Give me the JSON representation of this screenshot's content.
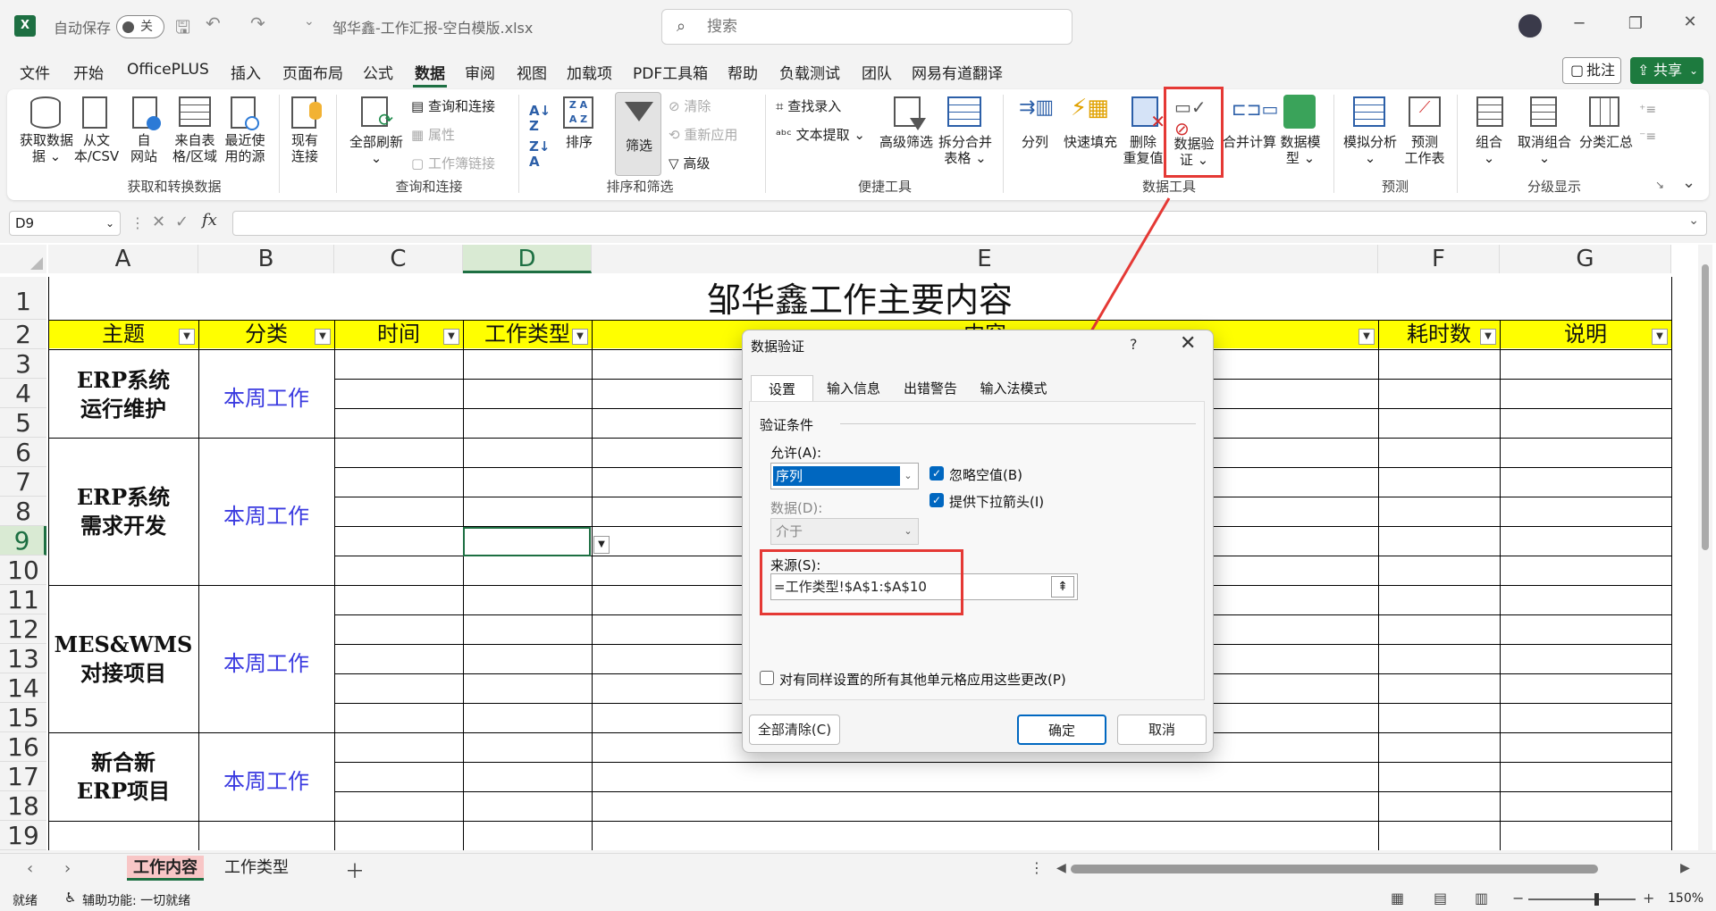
{
  "titlebar": {
    "autosave_label": "自动保存",
    "autosave_state": "关",
    "filename": "邹华鑫-工作汇报-空白模版.xlsx",
    "search_placeholder": "搜索"
  },
  "menu": {
    "items": [
      "文件",
      "开始",
      "OfficePLUS",
      "插入",
      "页面布局",
      "公式",
      "数据",
      "审阅",
      "视图",
      "加载项",
      "PDF工具箱",
      "帮助",
      "负载测试",
      "团队",
      "网易有道翻译"
    ],
    "active": "数据",
    "comment": "批注",
    "share": "共享"
  },
  "ribbon": {
    "get_data": "获取数据",
    "from_text_1": "从文",
    "from_text_2": "本/CSV",
    "from_web_1": "自",
    "from_web_2": "网站",
    "from_table_1": "来自表",
    "from_table_2": "格/区域",
    "recent_1": "最近使",
    "recent_2": "用的源",
    "existing_1": "现有",
    "existing_2": "连接",
    "group_get": "获取和转换数据",
    "refresh_all": "全部刷新",
    "query_conn": "查询和连接",
    "properties": "属性",
    "workbook_links": "工作簿链接",
    "group_query": "查询和连接",
    "sort": "排序",
    "filter": "筛选",
    "clear": "清除",
    "reapply": "重新应用",
    "advanced": "高级",
    "group_sort": "排序和筛选",
    "find_entry": "查找录入",
    "text_extract": "文本提取",
    "adv_filter": "高级筛选",
    "split_merge_1": "拆分合并",
    "split_merge_2": "表格",
    "group_tools": "便捷工具",
    "split_col": "分列",
    "flash_fill": "快速填充",
    "remove_dup_1": "删除",
    "remove_dup_2": "重复值",
    "validation_1": "数据验",
    "validation_2": "证",
    "consolidate": "合并计算",
    "data_model_1": "数据模",
    "data_model_2": "型",
    "group_datatools": "数据工具",
    "what_if": "模拟分析",
    "forecast_1": "预测",
    "forecast_2": "工作表",
    "group_forecast": "预测",
    "group_btn": "组合",
    "ungroup": "取消组合",
    "subtotal": "分类汇总",
    "group_outline": "分级显示"
  },
  "formula": {
    "namebox": "D9",
    "fx": "fx"
  },
  "columns": [
    "A",
    "B",
    "C",
    "D",
    "E",
    "F",
    "G"
  ],
  "rows": [
    "1",
    "2",
    "3",
    "4",
    "5",
    "6",
    "7",
    "8",
    "9",
    "10",
    "11",
    "12",
    "13",
    "14",
    "15",
    "16",
    "17",
    "18",
    "19"
  ],
  "sheet": {
    "title": "邹华鑫工作主要内容",
    "headers": [
      "主题",
      "分类",
      "时间",
      "工作类型",
      "内容",
      "耗时数",
      "说明"
    ],
    "sections": [
      {
        "topic_1": "ERP系统",
        "topic_2": "运行维护",
        "category": "本周工作"
      },
      {
        "topic_1": "ERP系统",
        "topic_2": "需求开发",
        "category": "本周工作"
      },
      {
        "topic_1": "MES&WMS",
        "topic_2": "对接项目",
        "category": "本周工作"
      },
      {
        "topic_1": "新合新",
        "topic_2": "ERP项目",
        "category": "本周工作"
      }
    ]
  },
  "dialog": {
    "title": "数据验证",
    "help": "?",
    "tabs": [
      "设置",
      "输入信息",
      "出错警告",
      "输入法模式"
    ],
    "section": "验证条件",
    "allow_label": "允许(A):",
    "allow_value": "序列",
    "ignore_blank": "忽略空值(B)",
    "dropdown": "提供下拉箭头(I)",
    "data_label": "数据(D):",
    "data_value": "介于",
    "source_label": "来源(S):",
    "source_value": "=工作类型!$A$1:$A$10",
    "apply_all": "对有同样设置的所有其他单元格应用这些更改(P)",
    "clear_all": "全部清除(C)",
    "ok": "确定",
    "cancel": "取消"
  },
  "sheet_tabs": [
    "工作内容",
    "工作类型"
  ],
  "status": {
    "ready": "就绪",
    "accessibility": "辅助功能: 一切就绪",
    "zoom": "150%"
  },
  "colors": {
    "accent": "#1d6f42",
    "header_fill": "#ffff00",
    "highlight": "#e53935",
    "category_text": "#3a3ae0"
  }
}
